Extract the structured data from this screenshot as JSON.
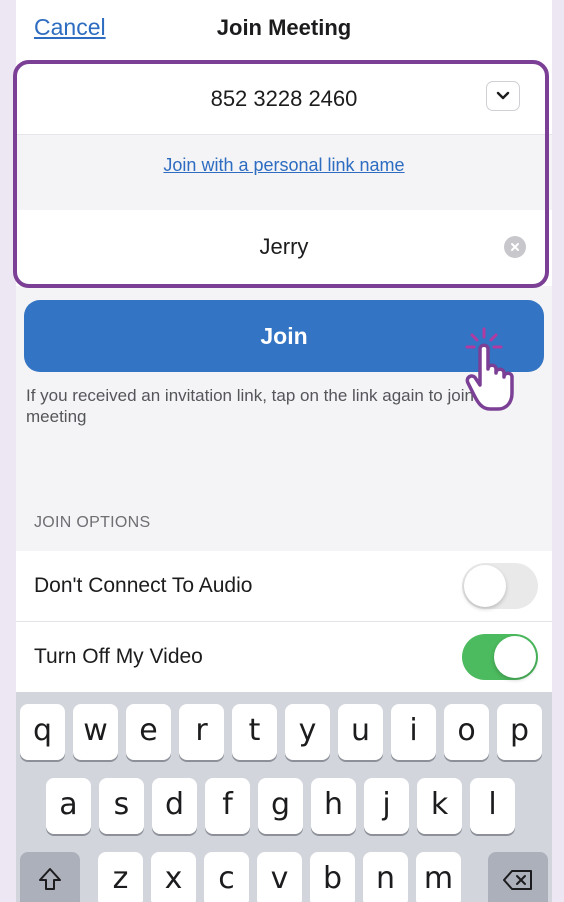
{
  "header": {
    "cancel": "Cancel",
    "title": "Join Meeting"
  },
  "form": {
    "meeting_id": "852 3228 2460",
    "personal_link": "Join with a personal link name",
    "name": "Jerry"
  },
  "join_button": "Join",
  "hint": "If you received an invitation link, tap on the link again to join the meeting",
  "join_options": {
    "label": "JOIN OPTIONS",
    "items": [
      {
        "label": "Don't Connect To Audio",
        "enabled": false
      },
      {
        "label": "Turn Off My Video",
        "enabled": true
      }
    ]
  },
  "keyboard": {
    "row1": [
      "q",
      "w",
      "e",
      "r",
      "t",
      "y",
      "u",
      "i",
      "o",
      "p"
    ],
    "row2": [
      "a",
      "s",
      "d",
      "f",
      "g",
      "h",
      "j",
      "k",
      "l"
    ],
    "row3": [
      "z",
      "x",
      "c",
      "v",
      "b",
      "n",
      "m"
    ],
    "shift_icon": "shift-icon",
    "delete_icon": "backspace-icon"
  },
  "colors": {
    "accent": "#3374c4",
    "highlight": "#7b3f95",
    "toggle_on": "#4cba5e"
  }
}
